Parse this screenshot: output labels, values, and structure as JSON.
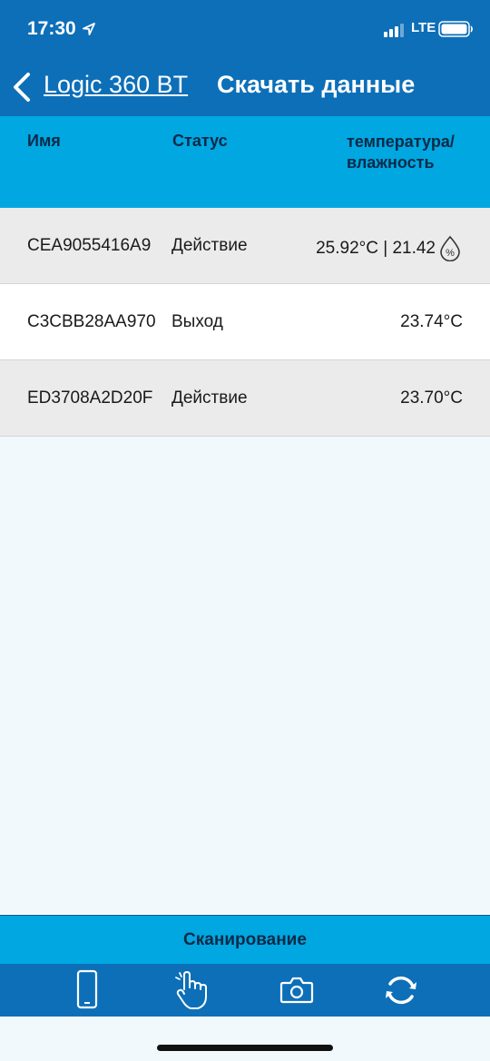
{
  "status_bar": {
    "time": "17:30",
    "network": "LTE"
  },
  "nav": {
    "back_label": "Logic 360 BT",
    "title": "Скачать данные"
  },
  "table": {
    "headers": {
      "name": "Имя",
      "status": "Статус",
      "temp": "температура/ влажность"
    },
    "rows": [
      {
        "name": "CEA9055416A9",
        "status": "Действие",
        "temp": "25.92°C | 21.42",
        "has_humidity_icon": true
      },
      {
        "name": "C3CBB28AA970",
        "status": "Выход",
        "temp": "23.74°C"
      },
      {
        "name": "ED3708A2D20F",
        "status": "Действие",
        "temp": "23.70°C"
      }
    ]
  },
  "scan_button": {
    "label": "Сканирование"
  },
  "tabs": [
    {
      "icon": "phone-icon"
    },
    {
      "icon": "hand-pointer-icon"
    },
    {
      "icon": "camera-icon"
    },
    {
      "icon": "sync-icon"
    }
  ],
  "colors": {
    "header_bg": "#0d6fb8",
    "accent": "#00a7e1",
    "row_alt": "#ebebeb",
    "background": "#f2f9fd"
  }
}
